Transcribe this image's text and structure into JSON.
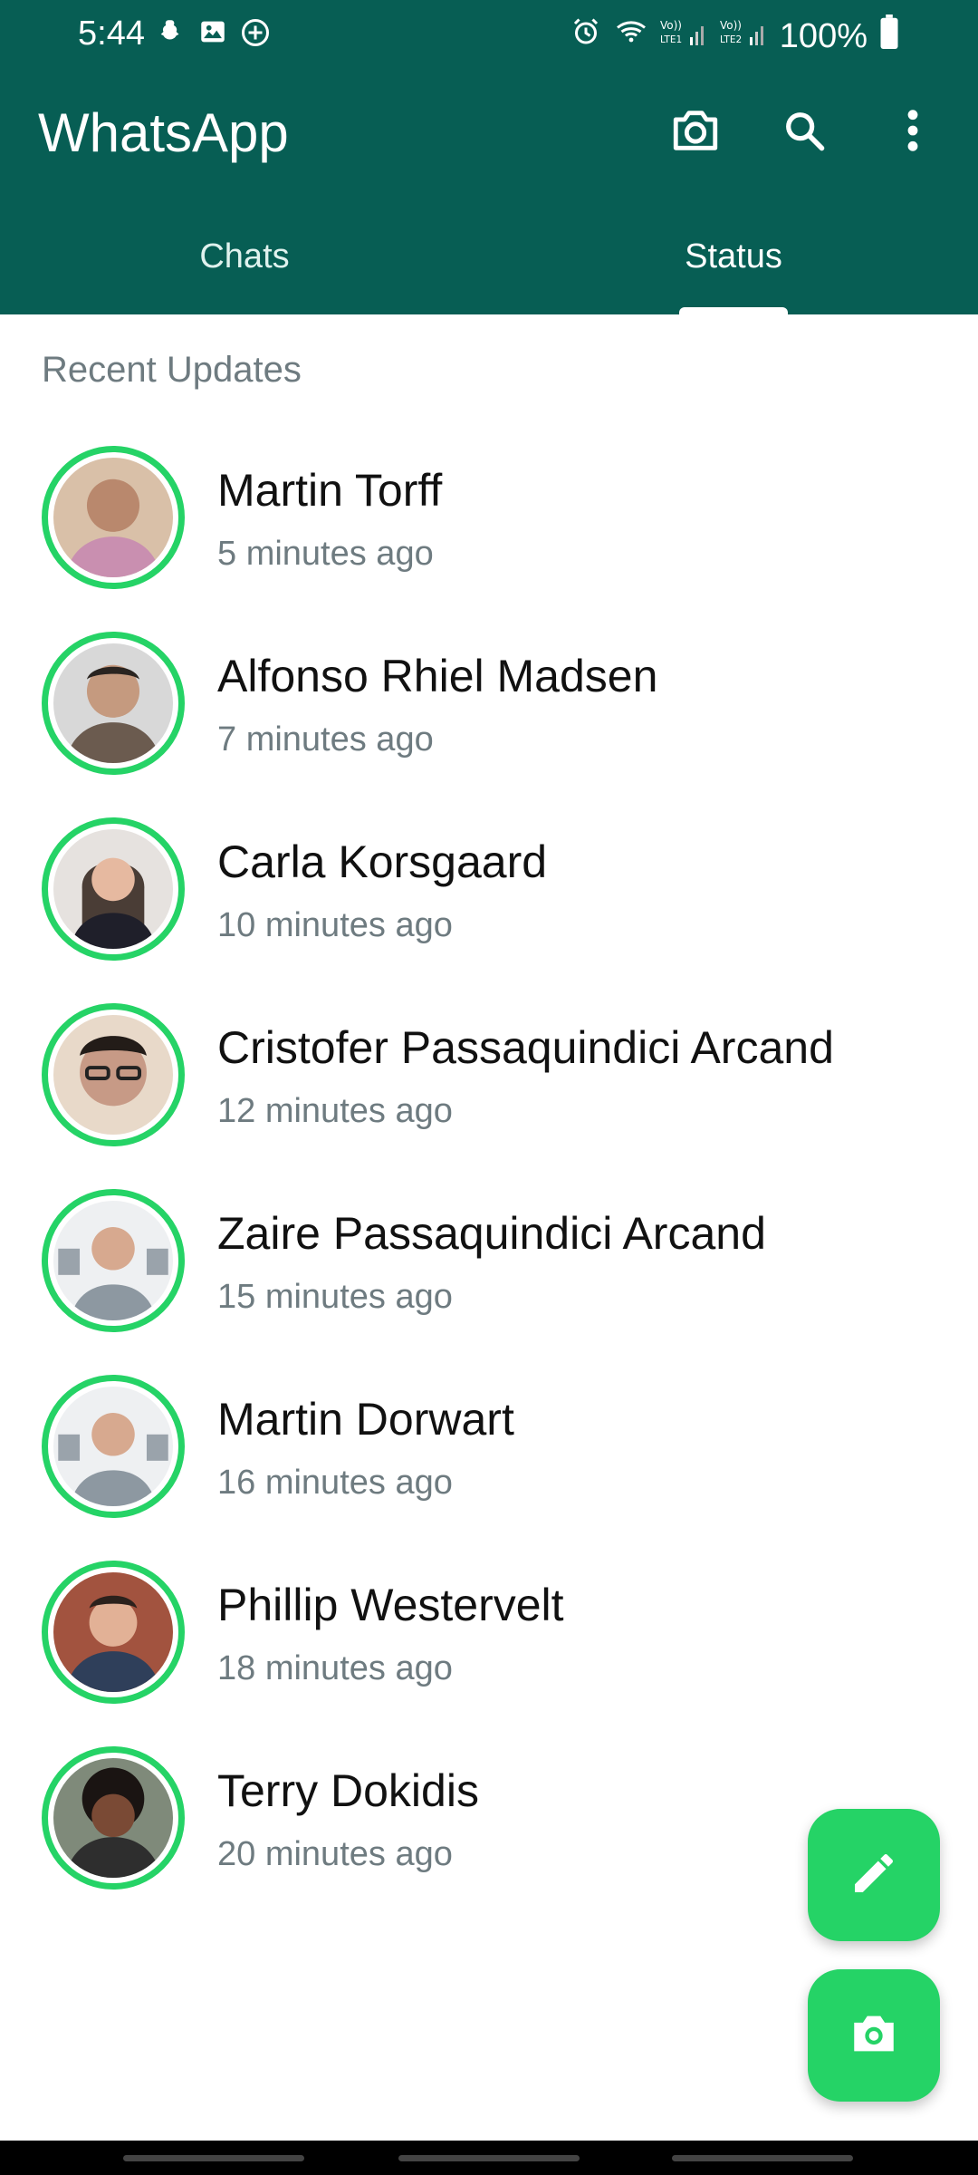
{
  "status_bar": {
    "time": "5:44",
    "battery": "100%",
    "icons_left": [
      "notification-icon",
      "gallery-icon",
      "add-circle-icon"
    ],
    "icons_right": [
      "alarm-icon",
      "wifi-icon",
      "signal-lte1-icon",
      "signal-lte2-icon",
      "battery-icon"
    ]
  },
  "header": {
    "title": "WhatsApp",
    "icons": [
      "camera-icon",
      "search-icon",
      "more-vert-icon"
    ],
    "background": "#075e54"
  },
  "tabs": [
    {
      "label": "Chats",
      "active": false
    },
    {
      "label": "Status",
      "active": true
    }
  ],
  "section_label": "Recent Updates",
  "statuses": [
    {
      "name": "Martin Torff",
      "time": "5 minutes ago",
      "avatar_color": "#b9886d"
    },
    {
      "name": "Alfonso Rhiel Madsen",
      "time": "7 minutes ago",
      "avatar_color": "#6b5b4f"
    },
    {
      "name": "Carla Korsgaard",
      "time": "10 minutes ago",
      "avatar_color": "#4a3d36"
    },
    {
      "name": "Cristofer Passaquindici Arcand",
      "time": "12 minutes ago",
      "avatar_color": "#7a6454"
    },
    {
      "name": "Zaire Passaquindici Arcand",
      "time": "15 minutes ago",
      "avatar_color": "#8d98a1"
    },
    {
      "name": "Martin Dorwart",
      "time": "16 minutes ago",
      "avatar_color": "#8d98a1"
    },
    {
      "name": "Phillip Westervelt",
      "time": "18 minutes ago",
      "avatar_color": "#2f3f5a"
    },
    {
      "name": "Terry Dokidis",
      "time": "20 minutes ago",
      "avatar_color": "#3a2a22"
    }
  ],
  "fabs": {
    "edit": "edit-icon",
    "camera": "camera-icon"
  },
  "colors": {
    "accent": "#25d366",
    "header": "#075e54",
    "secondary_text": "#6e7b80"
  }
}
